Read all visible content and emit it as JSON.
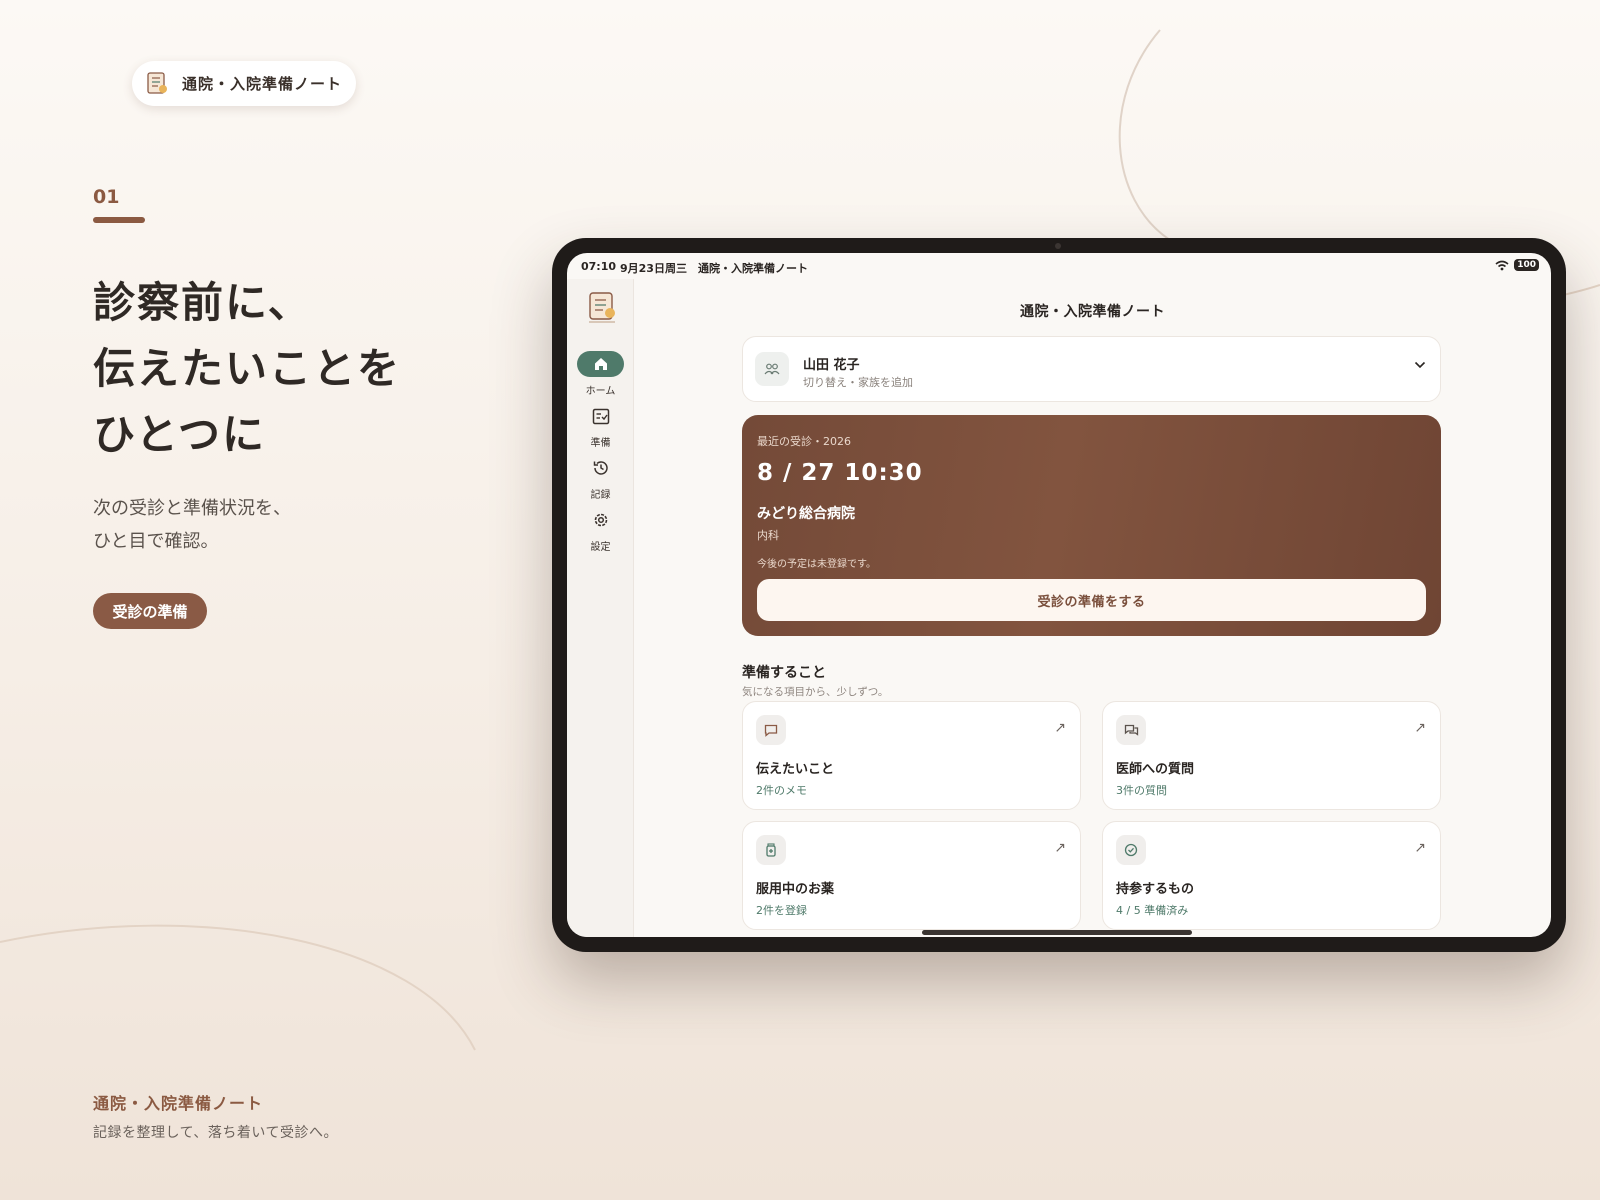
{
  "branding": {
    "app_name": "通院・入院準備ノート"
  },
  "hero": {
    "section_number": "01",
    "headline_lines": [
      "診察前に、",
      "伝えたいことを",
      "ひとつに"
    ],
    "subtext_lines": [
      "次の受診と準備状況を、",
      "ひと目で確認。"
    ],
    "cta_label": "受診の準備"
  },
  "footer": {
    "title": "通院・入院準備ノート",
    "subtitle": "記録を整理して、落ち着いて受診へ。"
  },
  "device": {
    "status_bar": {
      "time": "07:10",
      "date": "9月23日周三",
      "app": "通院・入院準備ノート",
      "battery": "100"
    },
    "sidebar": {
      "items": [
        {
          "label": "ホーム",
          "icon": "home-icon",
          "active": true
        },
        {
          "label": "準備",
          "icon": "checklist-icon",
          "active": false
        },
        {
          "label": "記録",
          "icon": "history-icon",
          "active": false
        },
        {
          "label": "設定",
          "icon": "gear-icon",
          "active": false
        }
      ]
    },
    "header": {
      "title": "通院・入院準備ノート"
    },
    "profile": {
      "name": "山田 花子",
      "subtitle": "切り替え・家族を追加"
    },
    "recent_visit": {
      "label": "最近の受診・2026",
      "datetime": "8 / 27  10:30",
      "hospital": "みどり総合病院",
      "department": "内科",
      "note": "今後の予定は未登録です。",
      "button_label": "受診の準備をする"
    },
    "prep": {
      "title": "準備すること",
      "subtitle": "気になる項目から、少しずつ。",
      "tiles": [
        {
          "title": "伝えたいこと",
          "sub": "2件のメモ",
          "icon": "message-icon"
        },
        {
          "title": "医師への質問",
          "sub": "3件の質問",
          "icon": "chat-question-icon"
        },
        {
          "title": "服用中のお薬",
          "sub": "2件を登録",
          "icon": "medicine-icon"
        },
        {
          "title": "持参するもの",
          "sub": "4 / 5 準備済み",
          "icon": "check-circle-icon"
        }
      ]
    }
  },
  "colors": {
    "accent_brown": "#8a5a45",
    "accent_green": "#4f7a6a",
    "card_brown": "#7a4f3c",
    "background": "#fcf9f5"
  }
}
